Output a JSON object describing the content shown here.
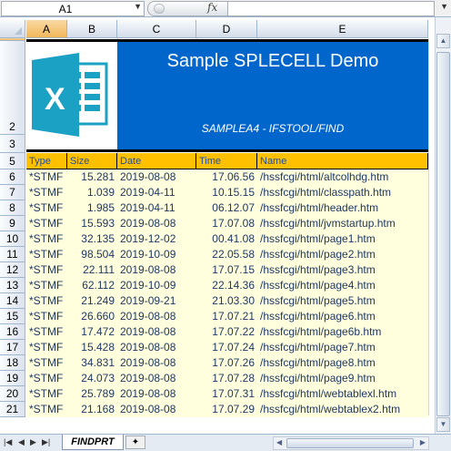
{
  "formula_bar": {
    "name_box": "A1",
    "fx_label": "fx",
    "formula": ""
  },
  "columns": [
    "A",
    "B",
    "C",
    "D",
    "E"
  ],
  "banner": {
    "title": "Sample SPLECELL Demo",
    "subtitle": "SAMPLEA4 - IFSTOOL/FIND",
    "logo_icon": "excel-logo-icon",
    "colors": {
      "panel": "#0066cc",
      "logo": "#1ba1c4"
    }
  },
  "header": {
    "type": "Type",
    "size": "Size",
    "date": "Date",
    "time": "Time",
    "name": "Name",
    "color": "#ffc000"
  },
  "rows": [
    {
      "row": "6",
      "type": "*STMF",
      "size": "15.281",
      "date": "2019-08-08",
      "time": "17.06.56",
      "name": "/hssfcgi/html/altcolhdg.htm"
    },
    {
      "row": "7",
      "type": "*STMF",
      "size": "1.039",
      "date": "2019-04-11",
      "time": "10.15.15",
      "name": "/hssfcgi/html/classpath.htm"
    },
    {
      "row": "8",
      "type": "*STMF",
      "size": "1.985",
      "date": "2019-04-11",
      "time": "06.12.07",
      "name": "/hssfcgi/html/header.htm"
    },
    {
      "row": "9",
      "type": "*STMF",
      "size": "15.593",
      "date": "2019-08-08",
      "time": "17.07.08",
      "name": "/hssfcgi/html/jvmstartup.htm"
    },
    {
      "row": "10",
      "type": "*STMF",
      "size": "32.135",
      "date": "2019-12-02",
      "time": "00.41.08",
      "name": "/hssfcgi/html/page1.htm"
    },
    {
      "row": "11",
      "type": "*STMF",
      "size": "98.504",
      "date": "2019-10-09",
      "time": "22.05.58",
      "name": "/hssfcgi/html/page2.htm"
    },
    {
      "row": "12",
      "type": "*STMF",
      "size": "22.111",
      "date": "2019-08-08",
      "time": "17.07.15",
      "name": "/hssfcgi/html/page3.htm"
    },
    {
      "row": "13",
      "type": "*STMF",
      "size": "62.112",
      "date": "2019-10-09",
      "time": "22.14.36",
      "name": "/hssfcgi/html/page4.htm"
    },
    {
      "row": "14",
      "type": "*STMF",
      "size": "21.249",
      "date": "2019-09-21",
      "time": "21.03.30",
      "name": "/hssfcgi/html/page5.htm"
    },
    {
      "row": "15",
      "type": "*STMF",
      "size": "26.660",
      "date": "2019-08-08",
      "time": "17.07.21",
      "name": "/hssfcgi/html/page6.htm"
    },
    {
      "row": "16",
      "type": "*STMF",
      "size": "17.472",
      "date": "2019-08-08",
      "time": "17.07.22",
      "name": "/hssfcgi/html/page6b.htm"
    },
    {
      "row": "17",
      "type": "*STMF",
      "size": "15.428",
      "date": "2019-08-08",
      "time": "17.07.24",
      "name": "/hssfcgi/html/page7.htm"
    },
    {
      "row": "18",
      "type": "*STMF",
      "size": "34.831",
      "date": "2019-08-08",
      "time": "17.07.26",
      "name": "/hssfcgi/html/page8.htm"
    },
    {
      "row": "19",
      "type": "*STMF",
      "size": "24.073",
      "date": "2019-08-08",
      "time": "17.07.28",
      "name": "/hssfcgi/html/page9.htm"
    },
    {
      "row": "20",
      "type": "*STMF",
      "size": "25.789",
      "date": "2019-08-08",
      "time": "17.07.31",
      "name": "/hssfcgi/html/webtablexl.htm"
    },
    {
      "row": "21",
      "type": "*STMF",
      "size": "21.168",
      "date": "2019-08-08",
      "time": "17.07.29",
      "name": "/hssfcgi/html/webtablex2.htm"
    }
  ],
  "row_labels": {
    "r1": "1",
    "r2": "2",
    "r3": "3",
    "r5": "5"
  },
  "sheet_tab": "FINDPRT"
}
